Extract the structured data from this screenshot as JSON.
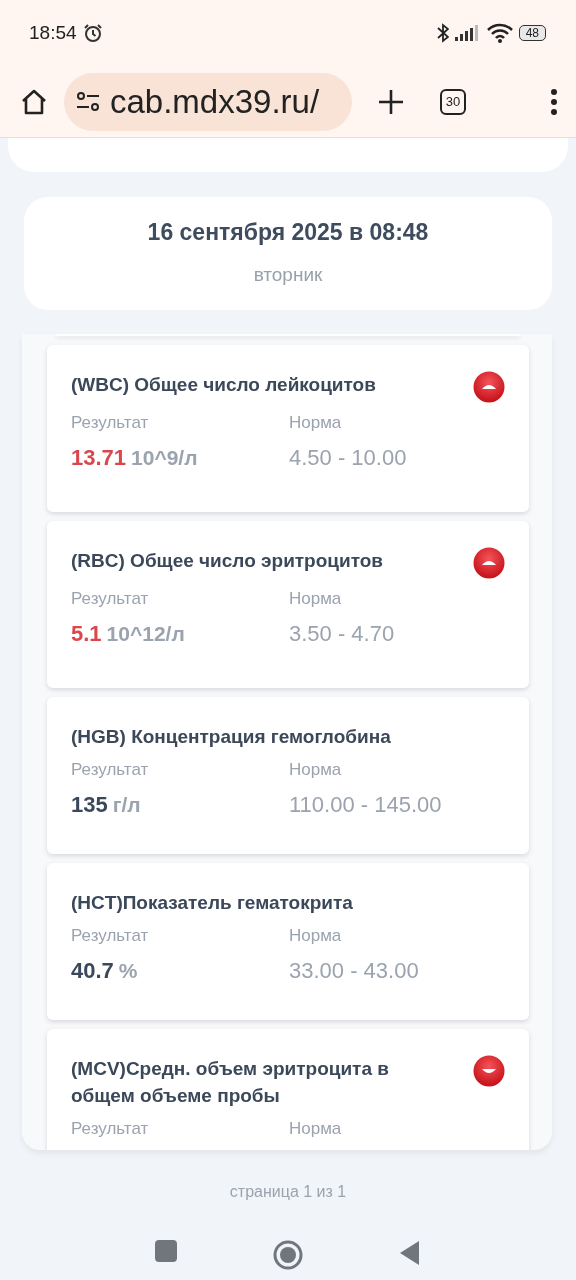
{
  "status_bar": {
    "time": "18:54",
    "battery": "48"
  },
  "browser": {
    "url": "cab.mdx39.ru/",
    "tab_count": "30"
  },
  "visit": {
    "date": "16 сентября 2025 в 08:48",
    "weekday": "вторник"
  },
  "results": [
    {
      "name": "(WBC) Общее число лейкоцитов",
      "result_label": "Результат",
      "value": "13.71",
      "unit": "10^9/л",
      "norm_label": "Норма",
      "norm": "4.50 - 10.00",
      "kind": "high"
    },
    {
      "name": "(RBC) Общее число эритроцитов",
      "result_label": "Результат",
      "value": "5.1",
      "unit": "10^12/л",
      "norm_label": "Норма",
      "norm": "3.50 - 4.70",
      "kind": "high"
    },
    {
      "name": "(HGB) Концентрация гемоглобина",
      "result_label": "Результат",
      "value": "135",
      "unit": "г/л",
      "norm_label": "Норма",
      "norm": "110.00 - 145.00",
      "kind": "normal"
    },
    {
      "name": "(HCT)Показатель гематокрита",
      "result_label": "Результат",
      "value": "40.7",
      "unit": "%",
      "norm_label": "Норма",
      "norm": "33.00 - 43.00",
      "kind": "normal"
    },
    {
      "name": "(MCV)Средн. объем эритроцита в общем объеме пробы",
      "result_label": "Результат",
      "norm_label": "Норма",
      "kind": "low"
    }
  ],
  "pagination": "страница 1 из 1"
}
